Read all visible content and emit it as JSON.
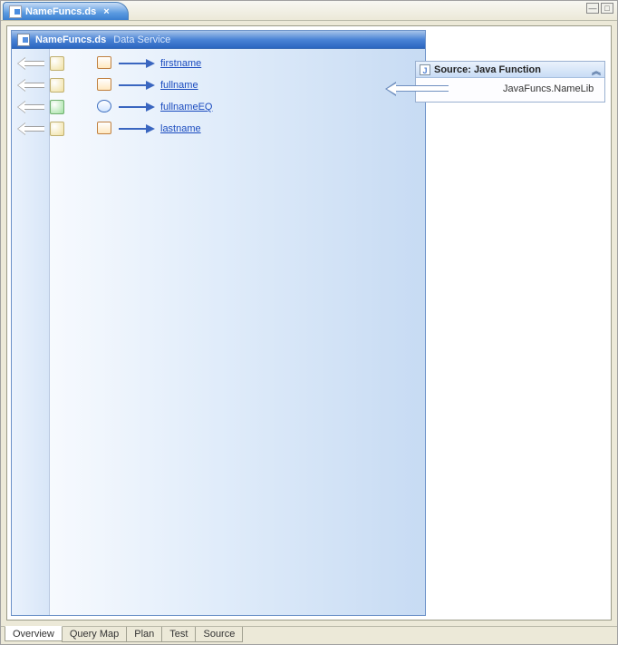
{
  "tab": {
    "title": "NameFuncs.ds"
  },
  "panel": {
    "title": "NameFuncs.ds",
    "subtitle": "Data Service"
  },
  "functions": [
    {
      "name": "firstname",
      "kind": "op"
    },
    {
      "name": "fullname",
      "kind": "op"
    },
    {
      "name": "fullnameEQ",
      "kind": "gear"
    },
    {
      "name": "lastname",
      "kind": "op"
    }
  ],
  "source": {
    "title": "Source: Java Function",
    "item": "JavaFuncs.NameLib"
  },
  "bottom_tabs": [
    "Overview",
    "Query Map",
    "Plan",
    "Test",
    "Source"
  ],
  "active_bottom_tab": 0
}
